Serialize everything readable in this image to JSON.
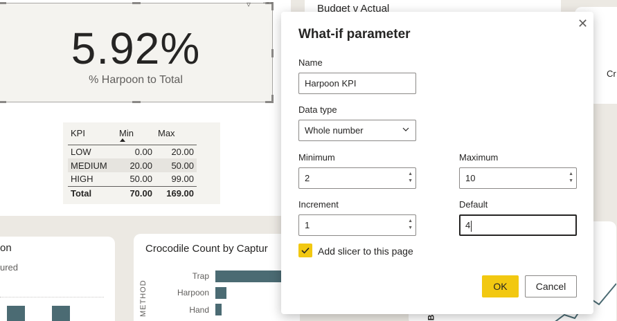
{
  "kpi_card": {
    "value": "5.92%",
    "label": "% Harpoon to Total",
    "table": {
      "headers": [
        "KPI",
        "Min",
        "Max"
      ],
      "rows": [
        {
          "kpi": "LOW",
          "min": "0.00",
          "max": "20.00"
        },
        {
          "kpi": "MEDIUM",
          "min": "20.00",
          "max": "50.00"
        },
        {
          "kpi": "HIGH",
          "min": "50.00",
          "max": "99.00"
        }
      ],
      "total": {
        "kpi": "Total",
        "min": "70.00",
        "max": "169.00"
      }
    }
  },
  "budget_card": {
    "title": "Budget v Actual"
  },
  "right_card": {
    "label": "Cr"
  },
  "bottom_left_card": {
    "title": "on",
    "subtitle": "ured"
  },
  "croc_card": {
    "title": "Crocodile Count by Captur",
    "axis_label": "METHOD",
    "categories": [
      "Trap",
      "Harpoon",
      "Hand"
    ],
    "colors": {
      "bar": "#4b6b73"
    }
  },
  "right_bottom": {
    "axis_letter": "B"
  },
  "dialog": {
    "title": "What-if parameter",
    "name_label": "Name",
    "name_value": "Harpoon KPI",
    "datatype_label": "Data type",
    "datatype_value": "Whole number",
    "minimum_label": "Minimum",
    "minimum_value": "2",
    "maximum_label": "Maximum",
    "maximum_value": "10",
    "increment_label": "Increment",
    "increment_value": "1",
    "default_label": "Default",
    "default_value": "4",
    "slicer_label": "Add slicer to this page",
    "slicer_checked": true,
    "ok_label": "OK",
    "cancel_label": "Cancel",
    "colors": {
      "accent": "#f2c811"
    }
  }
}
